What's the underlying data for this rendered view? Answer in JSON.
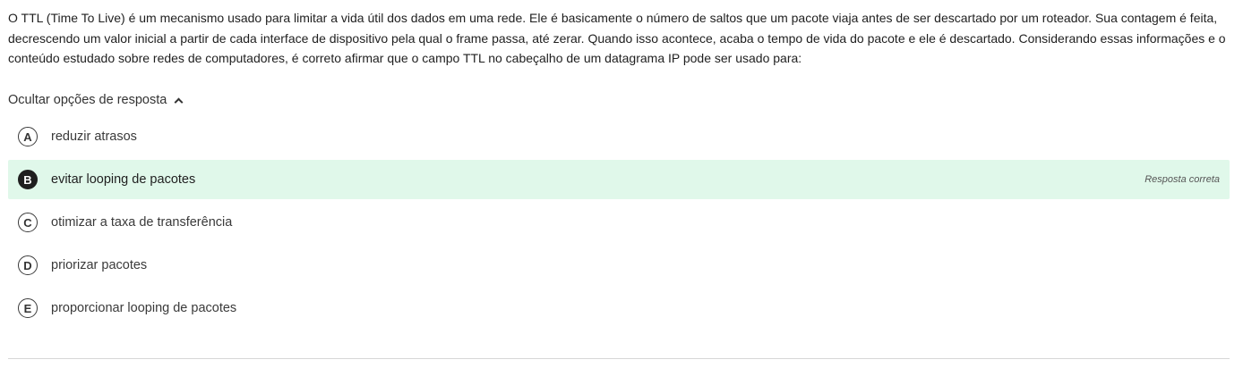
{
  "question": {
    "text": "O TTL (Time To Live) é um mecanismo usado para limitar a vida útil dos dados em uma rede. Ele é basicamente o número de saltos que um pacote viaja antes de ser descartado por um roteador. Sua contagem é feita, decrescendo um valor inicial a partir de cada interface de dispositivo pela qual o frame passa, até zerar. Quando isso acontece, acaba o tempo de vida do pacote e ele é descartado. Considerando essas informações e o conteúdo estudado sobre redes de computadores, é correto afirmar que o campo TTL no cabeçalho de um datagrama IP pode ser usado para:"
  },
  "toggle": {
    "label": "Ocultar opções de resposta",
    "icon": "chevron-up-icon"
  },
  "options": [
    {
      "letter": "A",
      "text": "reduzir atrasos"
    },
    {
      "letter": "B",
      "text": "evitar looping de pacotes",
      "correct": true,
      "status": "Resposta correta"
    },
    {
      "letter": "C",
      "text": "otimizar a taxa de transferência"
    },
    {
      "letter": "D",
      "text": "priorizar pacotes"
    },
    {
      "letter": "E",
      "text": "proporcionar looping de pacotes"
    }
  ],
  "colors": {
    "correct_background": "#e0f8ea",
    "selected_badge": "#1f1f1f"
  }
}
